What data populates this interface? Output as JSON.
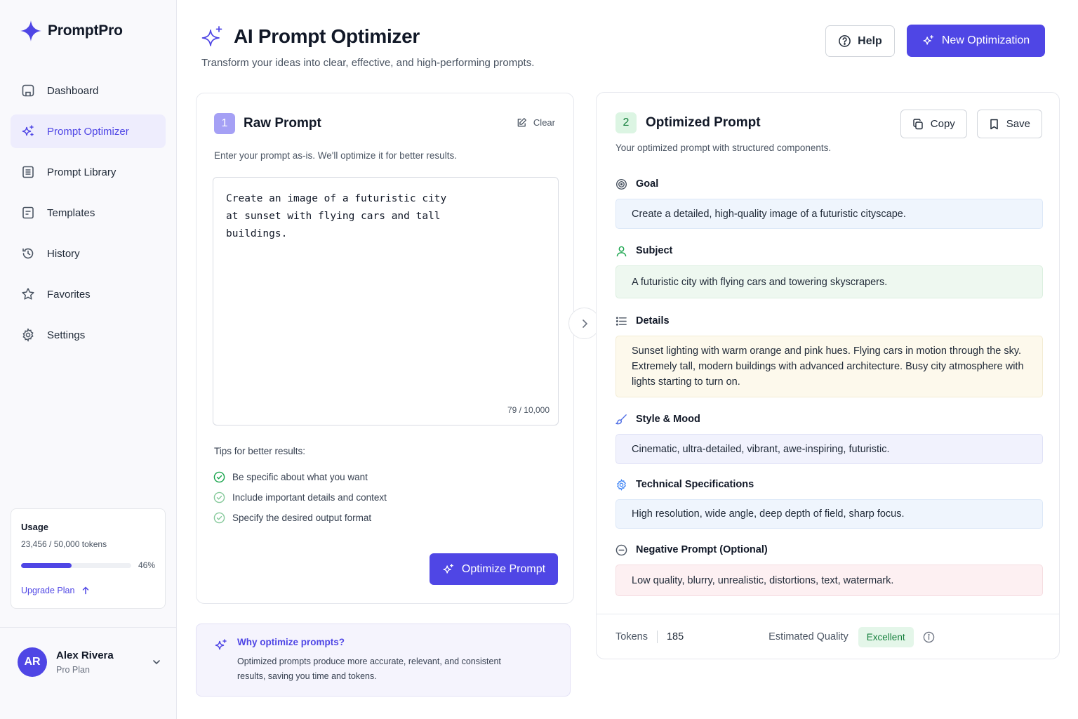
{
  "app": {
    "name": "PromptPro"
  },
  "sidebar": {
    "items": [
      {
        "label": "Dashboard",
        "icon": "home-icon",
        "active": false
      },
      {
        "label": "Prompt Optimizer",
        "icon": "sparkles-icon",
        "active": true
      },
      {
        "label": "Prompt Library",
        "icon": "library-icon",
        "active": false
      },
      {
        "label": "Templates",
        "icon": "template-icon",
        "active": false
      },
      {
        "label": "History",
        "icon": "history-icon",
        "active": false
      },
      {
        "label": "Favorites",
        "icon": "star-icon",
        "active": false
      },
      {
        "label": "Settings",
        "icon": "gear-icon",
        "active": false
      }
    ],
    "usage": {
      "title": "Usage",
      "tokens": "23,456 / 50,000 tokens",
      "percent_label": "46%",
      "percent": 46,
      "upgrade_label": "Upgrade Plan"
    },
    "user": {
      "initials": "AR",
      "name": "Alex Rivera",
      "plan": "Pro Plan"
    }
  },
  "header": {
    "title": "AI Prompt Optimizer",
    "subtitle": "Transform your ideas into clear, effective, and high-performing prompts.",
    "help_label": "Help",
    "new_label": "New Optimization"
  },
  "raw": {
    "step": "1",
    "title": "Raw Prompt",
    "clear_label": "Clear",
    "description": "Enter your prompt as-is. We'll optimize it for better results.",
    "text": "Create an image of a futuristic city at sunset with flying cars and tall buildings.",
    "char_count": "79 / 10,000",
    "tips_title": "Tips for better results:",
    "tips": [
      "Be specific about what you want",
      "Include important details and context",
      "Specify the desired output format"
    ],
    "optimize_label": "Optimize Prompt"
  },
  "why": {
    "title": "Why optimize prompts?",
    "text": "Optimized prompts produce more accurate, relevant, and consistent results, saving you time and tokens."
  },
  "optimized": {
    "step": "2",
    "title": "Optimized Prompt",
    "copy_label": "Copy",
    "save_label": "Save",
    "description": "Your optimized prompt with structured components.",
    "sections": {
      "goal": {
        "label": "Goal",
        "text": "Create a detailed, high-quality image of a futuristic cityscape."
      },
      "subject": {
        "label": "Subject",
        "text": "A futuristic city with flying cars and towering skyscrapers."
      },
      "details": {
        "label": "Details",
        "text": "Sunset lighting with warm orange and pink hues. Flying cars in motion through the sky. Extremely tall, modern buildings with advanced architecture. Busy city atmosphere with lights starting to turn on."
      },
      "style": {
        "label": "Style & Mood",
        "text": "Cinematic, ultra-detailed, vibrant, awe-inspiring, futuristic."
      },
      "tech": {
        "label": "Technical Specifications",
        "text": "High resolution, wide angle, deep depth of field, sharp focus."
      },
      "negative": {
        "label": "Negative Prompt (Optional)",
        "text": "Low quality, blurry, unrealistic, distortions, text, watermark."
      }
    },
    "footer": {
      "tokens_label": "Tokens",
      "tokens_value": "185",
      "quality_label": "Estimated Quality",
      "quality_value": "Excellent"
    }
  },
  "colors": {
    "accent": "#4f46e5",
    "success": "#15803d",
    "active_bg": "#eeedfd"
  }
}
